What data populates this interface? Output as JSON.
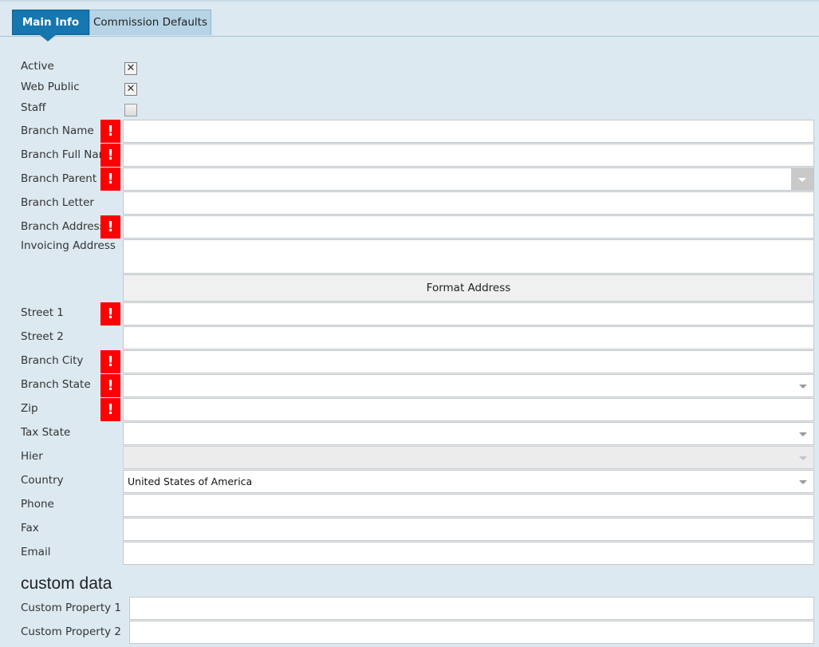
{
  "tabs": {
    "main": "Main Info",
    "commission": "Commission Defaults"
  },
  "labels": {
    "active": "Active",
    "web_public": "Web Public",
    "staff": "Staff",
    "branch_name": "Branch Name",
    "branch_full_name": "Branch Full Nar",
    "branch_parent": "Branch Parent",
    "branch_letter": "Branch Letter",
    "branch_address": "Branch Address",
    "invoicing_address": "Invoicing Address",
    "street1": "Street 1",
    "street2": "Street 2",
    "branch_city": "Branch City",
    "branch_state": "Branch State",
    "zip": "Zip",
    "tax_state": "Tax State",
    "hier": "Hier",
    "country": "Country",
    "phone": "Phone",
    "fax": "Fax",
    "email": "Email",
    "custom1": "Custom Property 1",
    "custom2": "Custom Property 2"
  },
  "checkboxes": {
    "active": "✕",
    "web_public": "✕",
    "staff": ""
  },
  "required_marker": "!",
  "format_address_button": "Format Address",
  "country_value": "United States of America",
  "section_custom": "custom data",
  "colors": {
    "tab_active": "#1576b0",
    "required": "#ff0000",
    "background": "#dce9f1"
  }
}
